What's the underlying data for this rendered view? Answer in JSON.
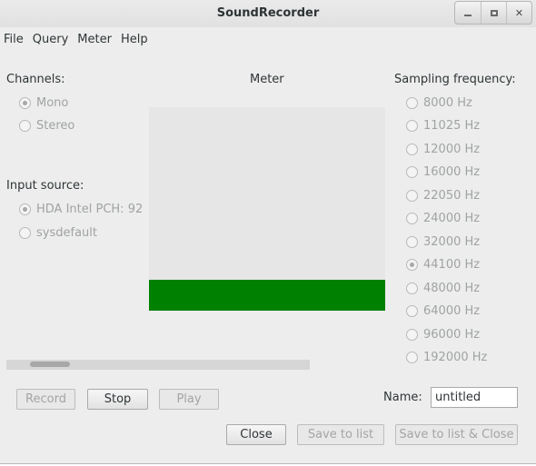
{
  "window": {
    "title": "SoundRecorder"
  },
  "menu": [
    "File",
    "Query",
    "Meter",
    "Help"
  ],
  "channels": {
    "label": "Channels:",
    "options": [
      {
        "label": "Mono",
        "selected": true
      },
      {
        "label": "Stereo",
        "selected": false
      }
    ]
  },
  "input_source": {
    "label": "Input source:",
    "options": [
      {
        "label": "HDA Intel PCH: 92",
        "selected": true
      },
      {
        "label": "sysdefault",
        "selected": false
      }
    ]
  },
  "meter": {
    "label": "Meter",
    "level": 0.15,
    "color": "#008000"
  },
  "sampling": {
    "label": "Sampling frequency:",
    "options": [
      {
        "label": "8000 Hz",
        "selected": false
      },
      {
        "label": "11025 Hz",
        "selected": false
      },
      {
        "label": "12000 Hz",
        "selected": false
      },
      {
        "label": "16000 Hz",
        "selected": false
      },
      {
        "label": "22050 Hz",
        "selected": false
      },
      {
        "label": "24000 Hz",
        "selected": false
      },
      {
        "label": "32000 Hz",
        "selected": false
      },
      {
        "label": "44100 Hz",
        "selected": true
      },
      {
        "label": "48000 Hz",
        "selected": false
      },
      {
        "label": "64000 Hz",
        "selected": false
      },
      {
        "label": "96000 Hz",
        "selected": false
      },
      {
        "label": "192000 Hz",
        "selected": false
      }
    ]
  },
  "controls": {
    "record": "Record",
    "stop": "Stop",
    "play": "Play"
  },
  "name": {
    "label": "Name:",
    "value": "untitled"
  },
  "footer": {
    "close": "Close",
    "save_to_list": "Save to list",
    "save_to_list_close": "Save to list & Close"
  }
}
